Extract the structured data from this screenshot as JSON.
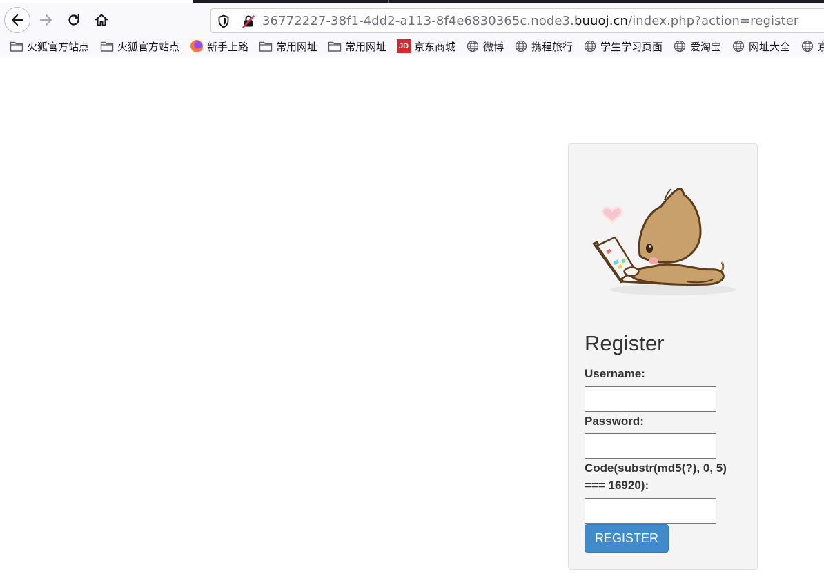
{
  "browser": {
    "url": {
      "prefix": "36772227-38f1-4dd2-a113-8f4e6830365c.node3.",
      "domain": "buuoj.cn",
      "path": "/index.php?action=register"
    },
    "bookmarks": [
      {
        "label": "火狐官方站点",
        "icon": "folder-icon"
      },
      {
        "label": "火狐官方站点",
        "icon": "folder-icon"
      },
      {
        "label": "新手上路",
        "icon": "firefox-icon"
      },
      {
        "label": "常用网址",
        "icon": "folder-icon"
      },
      {
        "label": "常用网址",
        "icon": "folder-icon"
      },
      {
        "label": "京东商城",
        "icon": "jd-icon",
        "icon_text": "JD"
      },
      {
        "label": "微博",
        "icon": "globe-icon"
      },
      {
        "label": "携程旅行",
        "icon": "globe-icon"
      },
      {
        "label": "学生学习页面",
        "icon": "globe-icon"
      },
      {
        "label": "爱淘宝",
        "icon": "globe-icon"
      },
      {
        "label": "网址大全",
        "icon": "globe-icon"
      },
      {
        "label": "京",
        "icon": "globe-icon"
      }
    ]
  },
  "form": {
    "title": "Register",
    "username_label": "Username:",
    "password_label": "Password:",
    "code_label": "Code(substr(md5(?), 0, 5) === 16920):",
    "username_value": "",
    "password_value": "",
    "code_value": "",
    "submit_label": "REGISTER",
    "button_color": "#428bca"
  },
  "mascot": {
    "icon": "cat-with-laptop-illustration"
  }
}
